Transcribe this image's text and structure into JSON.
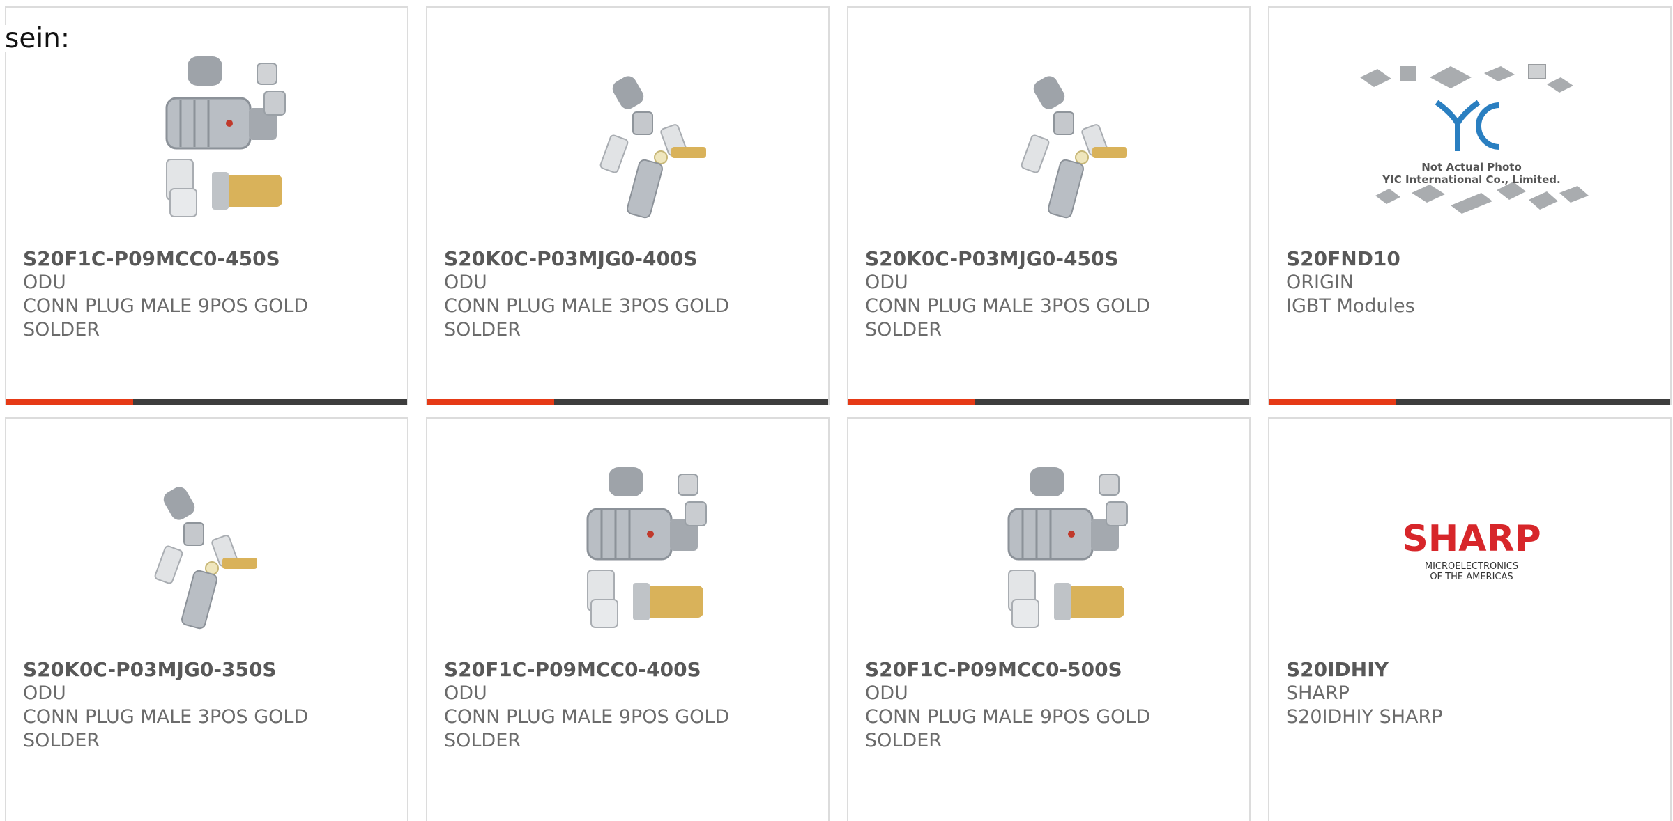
{
  "intro_fragment": "sein:",
  "products": [
    {
      "part": "S20F1C-P09MCC0-450S",
      "maker": "ODU",
      "desc": "CONN PLUG MALE 9POS GOLD SOLDER"
    },
    {
      "part": "S20K0C-P03MJG0-400S",
      "maker": "ODU",
      "desc": "CONN PLUG MALE 3POS GOLD SOLDER"
    },
    {
      "part": "S20K0C-P03MJG0-450S",
      "maker": "ODU",
      "desc": "CONN PLUG MALE 3POS GOLD SOLDER"
    },
    {
      "part": "S20FND10",
      "maker": "ORIGIN",
      "desc": "IGBT Modules",
      "placeholder": {
        "logo": "YIC",
        "line1": "Not Actual Photo",
        "line2": "YIC International Co., Limited."
      }
    },
    {
      "part": "S20K0C-P03MJG0-350S",
      "maker": "ODU",
      "desc": "CONN PLUG MALE 3POS GOLD SOLDER"
    },
    {
      "part": "S20F1C-P09MCC0-400S",
      "maker": "ODU",
      "desc": "CONN PLUG MALE 9POS GOLD SOLDER"
    },
    {
      "part": "S20F1C-P09MCC0-500S",
      "maker": "ODU",
      "desc": "CONN PLUG MALE 9POS GOLD SOLDER"
    },
    {
      "part": "S20IDHIY",
      "maker": "SHARP",
      "desc": "S20IDHIY SHARP",
      "logo": {
        "brand": "SHARP",
        "line1": "MICROELECTRONICS",
        "line2": "OF THE AMERICAS"
      }
    }
  ],
  "colors": {
    "accent": "#e63a16",
    "bar": "#3d3d3d",
    "sharp_red": "#d7262a",
    "yic_blue": "#2a7fc1"
  }
}
